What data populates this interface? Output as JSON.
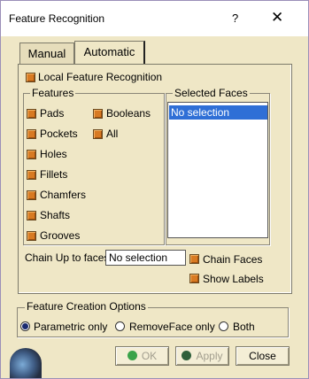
{
  "window": {
    "title": "Feature Recognition",
    "help_glyph": "?",
    "close_glyph": "✕"
  },
  "tabs": [
    {
      "label": "Manual",
      "active": false
    },
    {
      "label": "Automatic",
      "active": true
    }
  ],
  "local_feature_recognition": {
    "label": "Local Feature Recognition",
    "checked": true
  },
  "features": {
    "legend": "Features",
    "left": [
      {
        "label": "Pads",
        "checked": true
      },
      {
        "label": "Pockets",
        "checked": true
      },
      {
        "label": "Holes",
        "checked": true
      },
      {
        "label": "Fillets",
        "checked": true
      },
      {
        "label": "Chamfers",
        "checked": true
      },
      {
        "label": "Shafts",
        "checked": true
      },
      {
        "label": "Grooves",
        "checked": true
      }
    ],
    "right": [
      {
        "label": "Booleans",
        "checked": true
      },
      {
        "label": "All",
        "checked": true
      }
    ]
  },
  "selected_faces": {
    "legend": "Selected Faces",
    "items": [
      "No selection"
    ]
  },
  "chain_up": {
    "label": "Chain Up to faces",
    "value": "No selection"
  },
  "chain_faces": {
    "label": "Chain Faces",
    "checked": true
  },
  "show_labels": {
    "label": "Show Labels",
    "checked": true
  },
  "creation_options": {
    "legend": "Feature Creation Options",
    "options": [
      {
        "label": "Parametric only",
        "selected": true
      },
      {
        "label": "RemoveFace only",
        "selected": false
      },
      {
        "label": "Both",
        "selected": false
      }
    ]
  },
  "buttons": {
    "ok": "OK",
    "apply": "Apply",
    "close": "Close"
  },
  "colors": {
    "dialog_bg": "#efe7c6",
    "checkbox": "#d87a22",
    "selection": "#2f6fd6",
    "ok_icon": "#3aa34a",
    "apply_icon": "#2e5f3a"
  }
}
